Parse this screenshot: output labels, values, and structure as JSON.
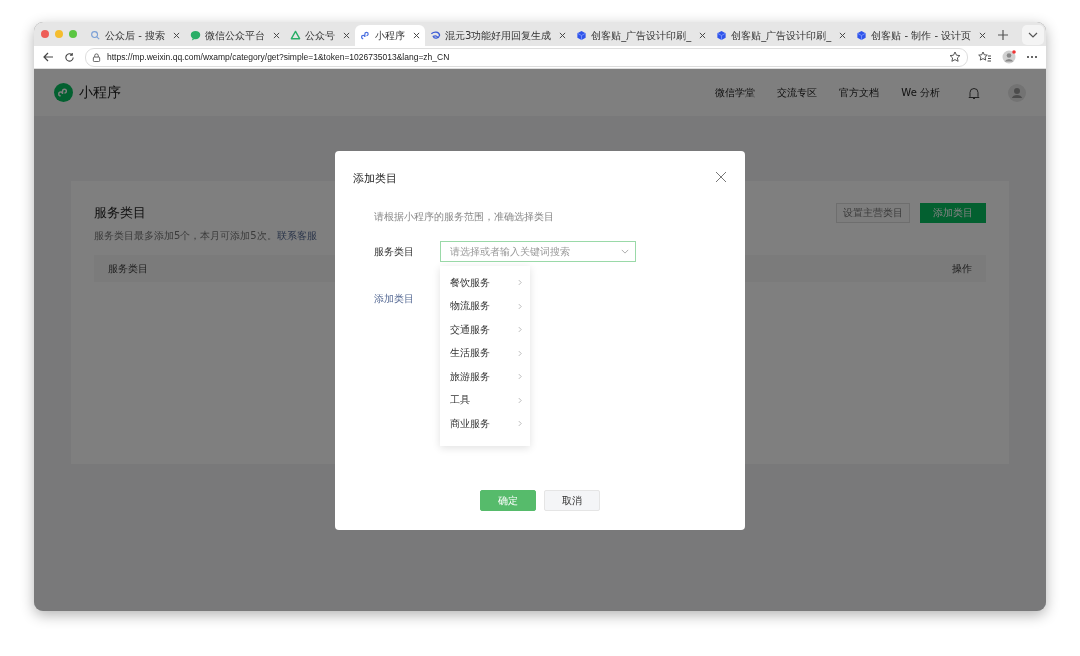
{
  "browser": {
    "tabs": [
      {
        "title": "公众后 - 搜索",
        "kind": "search",
        "selected": false
      },
      {
        "title": "微信公众平台",
        "kind": "chat",
        "selected": false
      },
      {
        "title": "公众号",
        "kind": "cycle",
        "selected": false
      },
      {
        "title": "小程序",
        "kind": "link",
        "selected": true
      },
      {
        "title": "混元3功能好用回复生成",
        "kind": "swirl",
        "selected": false
      },
      {
        "title": "创客贴_广告设计印刷_",
        "kind": "cube",
        "selected": false
      },
      {
        "title": "创客贴_广告设计印刷_",
        "kind": "cube",
        "selected": false
      },
      {
        "title": "创客贴 - 制作 - 设计页",
        "kind": "cube",
        "selected": false
      }
    ],
    "url": "https://mp.weixin.qq.com/wxamp/category/get?simple=1&token=1026735013&lang=zh_CN"
  },
  "header": {
    "logo_text": "小程序",
    "nav": [
      "微信学堂",
      "交流专区",
      "官方文档",
      "We 分析"
    ]
  },
  "card": {
    "title": "服务类目",
    "note": "服务类目最多添加5个，本月可添加5次。",
    "note_link": "联系客服",
    "buttons": [
      {
        "label": "设置主营类目",
        "disabled": true
      },
      {
        "label": "添加类目",
        "disabled": false
      }
    ],
    "columns": [
      "服务类目",
      "操作"
    ]
  },
  "dialog": {
    "title": "添加类目",
    "hint": "请根据小程序的服务范围，准确选择类目",
    "field_label": "服务类目",
    "select": {
      "placeholder": "请选择或者输入关键词搜索"
    },
    "add_link": "添加类目",
    "options": [
      "餐饮服务",
      "物流服务",
      "交通服务",
      "生活服务",
      "旅游服务",
      "工具",
      "商业服务"
    ],
    "buttons": [
      {
        "label": "确定",
        "kind": "primary"
      },
      {
        "label": "取消",
        "kind": "default"
      }
    ]
  }
}
